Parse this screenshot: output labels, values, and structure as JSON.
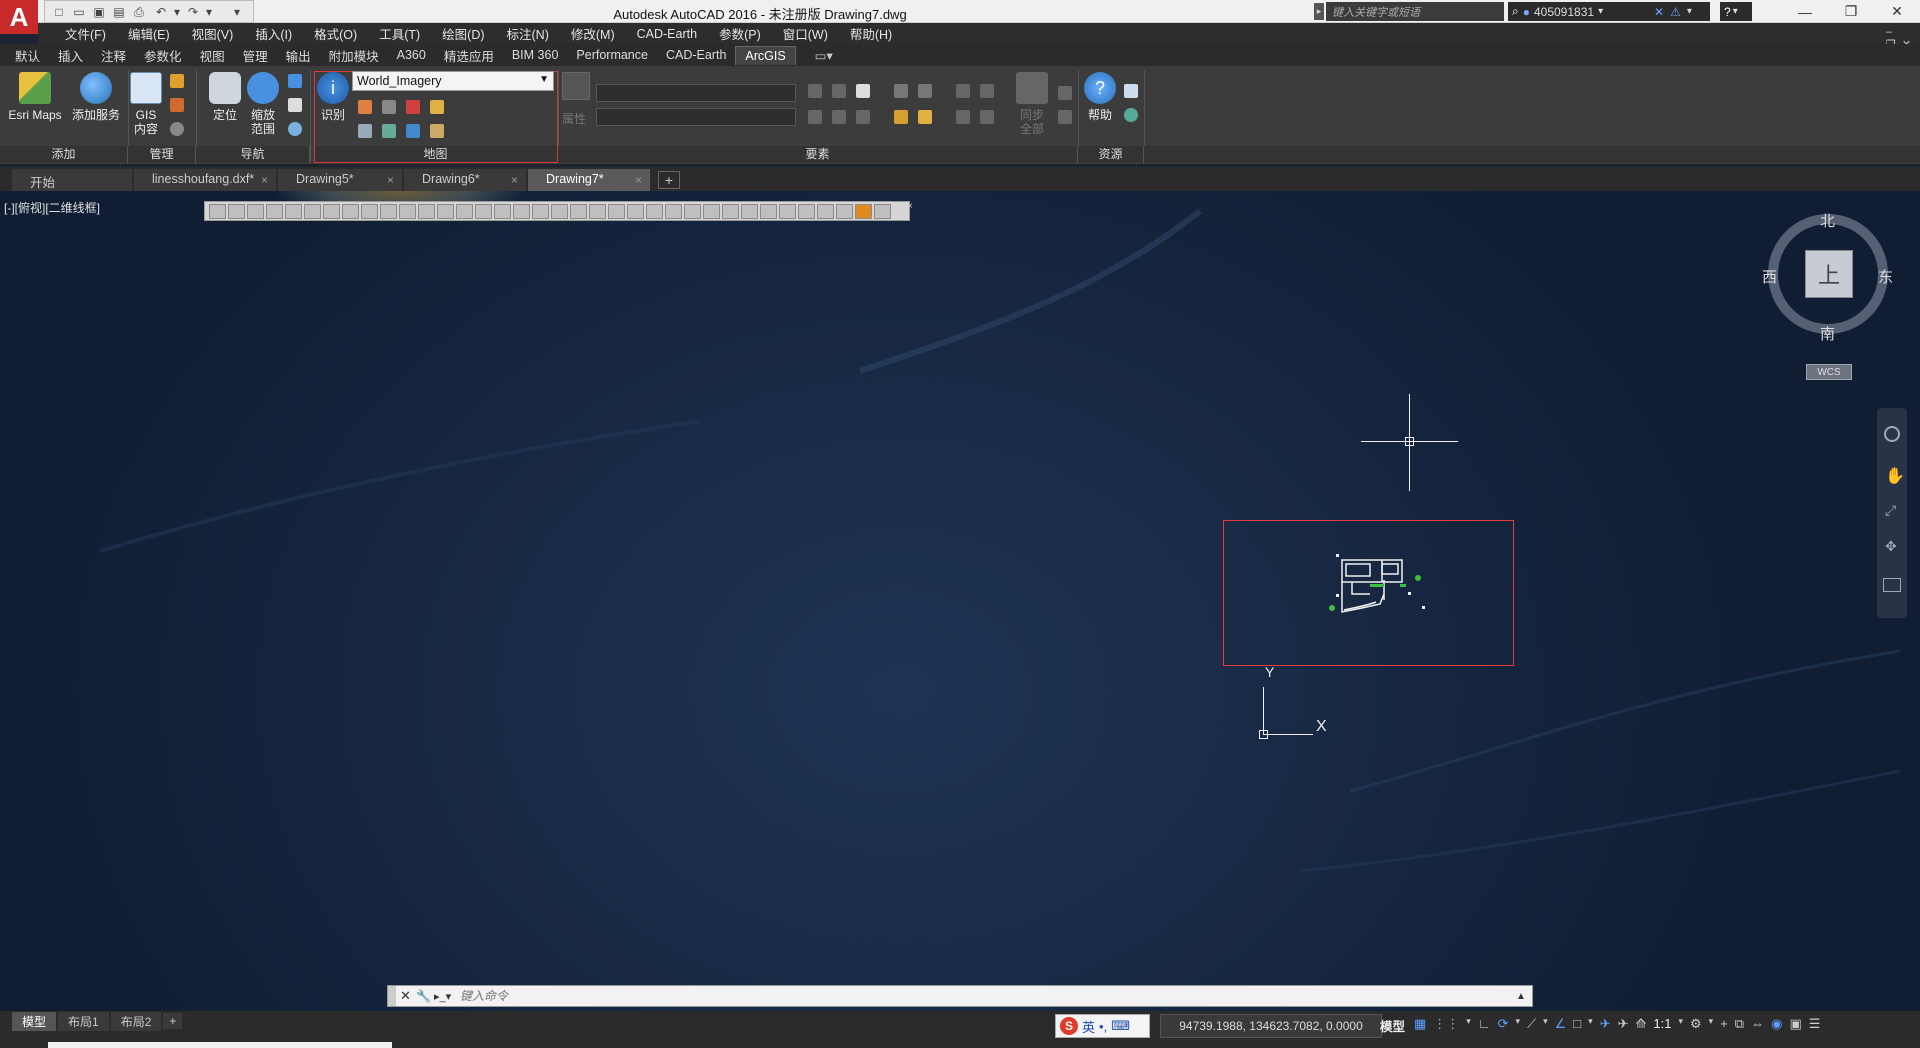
{
  "titlebar": {
    "title": "Autodesk AutoCAD 2016 - 未注册版    Drawing7.dwg",
    "search_placeholder": "键入关键字或短语",
    "user": "405091831",
    "logo": "A"
  },
  "menu": [
    "文件(F)",
    "编辑(E)",
    "视图(V)",
    "插入(I)",
    "格式(O)",
    "工具(T)",
    "绘图(D)",
    "标注(N)",
    "修改(M)",
    "CAD-Earth",
    "参数(P)",
    "窗口(W)",
    "帮助(H)"
  ],
  "ribbon_tabs": [
    "默认",
    "插入",
    "注释",
    "参数化",
    "视图",
    "管理",
    "输出",
    "附加模块",
    "A360",
    "精选应用",
    "BIM 360",
    "Performance",
    "CAD-Earth",
    "ArcGIS"
  ],
  "ribbon_active_tab": "ArcGIS",
  "ribbon": {
    "esri_maps": "Esri Maps",
    "add_service": "添加服务",
    "gis_content_1": "GIS",
    "gis_content_2": "内容",
    "locate": "定位",
    "zoom_extent_1": "缩放",
    "zoom_extent_2": "范围",
    "identify": "识别",
    "basemap": "World_Imagery",
    "attributes": "属性",
    "sync_1": "同步",
    "sync_2": "全部",
    "help": "帮助",
    "groups": {
      "add": "添加",
      "manage": "管理",
      "navigate": "导航",
      "map": "地图",
      "features": "要素",
      "resources": "资源"
    }
  },
  "doc_tabs": [
    {
      "label": "开始",
      "close": ""
    },
    {
      "label": "linesshoufang.dxf*",
      "close": "×"
    },
    {
      "label": "Drawing5*",
      "close": "×"
    },
    {
      "label": "Drawing6*",
      "close": "×"
    },
    {
      "label": "Drawing7*",
      "close": "×"
    }
  ],
  "active_doc": "Drawing7*",
  "viewport": {
    "label": "[-][俯视][二维线框]"
  },
  "viewcube": {
    "north": "北",
    "south": "南",
    "west": "西",
    "east": "东",
    "face": "上",
    "wcs": "WCS"
  },
  "ucs": {
    "x": "X",
    "y": "Y"
  },
  "command": {
    "placeholder": "键入命令"
  },
  "layout_tabs": [
    "模型",
    "布局1",
    "布局2"
  ],
  "status": {
    "ime_label": "英",
    "coords": "94739.1988, 134623.7082, 0.0000",
    "model": "模型",
    "scale": "1:1"
  },
  "colors": {
    "accent": "#d9373c",
    "app_red": "#c62a2a"
  }
}
